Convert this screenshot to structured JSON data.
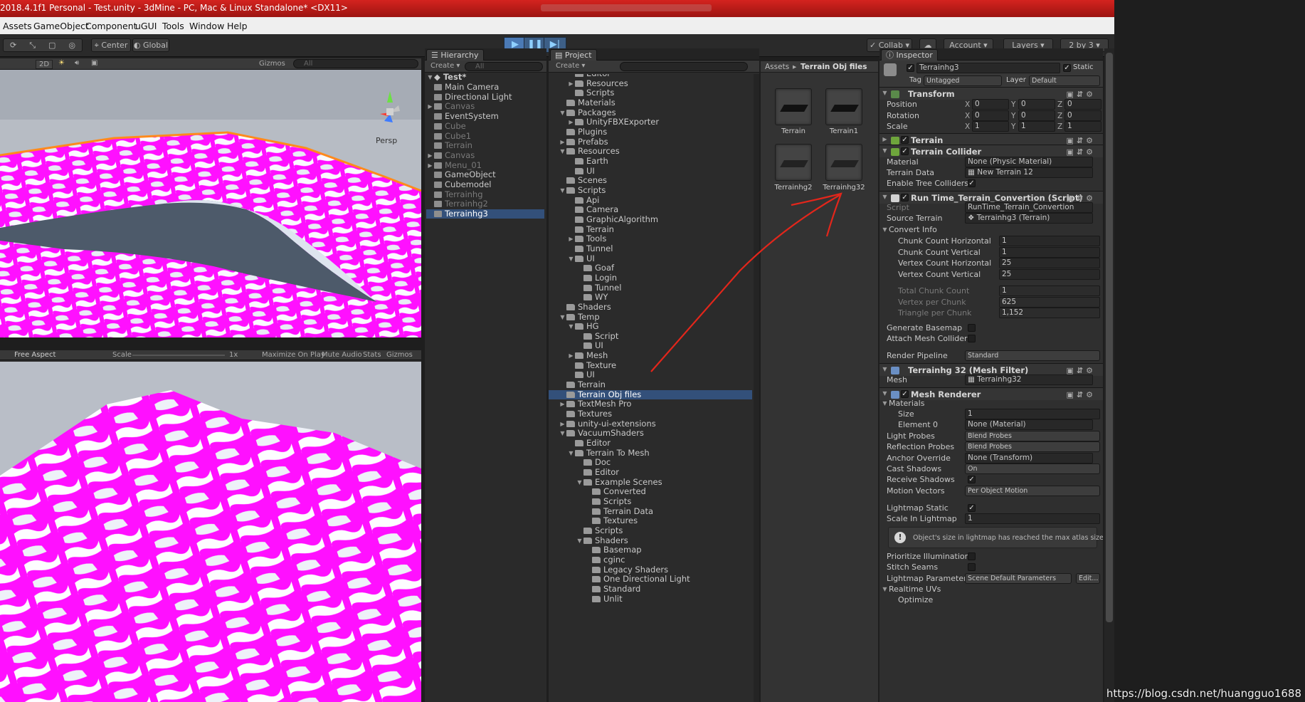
{
  "titlebar": {
    "title": "2018.4.1f1 Personal - Test.unity - 3dMine - PC, Mac & Linux Standalone* <DX11>"
  },
  "menu": [
    "Assets",
    "GameObject",
    "Component",
    "uGUI",
    "Tools",
    "Window",
    "Help"
  ],
  "toolbar": {
    "center": "Center",
    "global": "Global",
    "collab": "Collab",
    "account": "Account",
    "layers": "Layers",
    "layout": "2 by 3"
  },
  "scene": {
    "mode2d": "2D",
    "gizmos": "Gizmos",
    "search": "All",
    "persp": "Persp"
  },
  "game": {
    "aspect": "Free Aspect",
    "scale": "Scale",
    "scale_val": "1x",
    "maximize": "Maximize On Play",
    "mute": "Mute Audio",
    "stats": "Stats",
    "gizmos": "Gizmos"
  },
  "hierarchy": {
    "tab": "Hierarchy",
    "create": "Create",
    "search": "All",
    "scene": "Test*",
    "items": [
      {
        "label": "Main Camera",
        "arrow": "",
        "dim": false
      },
      {
        "label": "Directional Light",
        "arrow": "",
        "dim": false
      },
      {
        "label": "Canvas",
        "arrow": "▶",
        "dim": true
      },
      {
        "label": "EventSystem",
        "arrow": "",
        "dim": false
      },
      {
        "label": "Cube",
        "arrow": "",
        "dim": true
      },
      {
        "label": "Cube1",
        "arrow": "",
        "dim": true
      },
      {
        "label": "Terrain",
        "arrow": "",
        "dim": true
      },
      {
        "label": "Canvas",
        "arrow": "▶",
        "dim": true
      },
      {
        "label": "Menu_01",
        "arrow": "▶",
        "dim": true
      },
      {
        "label": "GameObject",
        "arrow": "",
        "dim": false
      },
      {
        "label": "Cubemodel",
        "arrow": "",
        "dim": false
      },
      {
        "label": "Terrainhg",
        "arrow": "",
        "dim": true
      },
      {
        "label": "Terrainhg2",
        "arrow": "",
        "dim": true
      },
      {
        "label": "Terrainhg3",
        "arrow": "",
        "dim": false,
        "selected": true
      }
    ]
  },
  "project": {
    "tab": "Project",
    "create": "Create",
    "tree": [
      {
        "label": "Editor",
        "level": 2,
        "arrow": ""
      },
      {
        "label": "Resources",
        "level": 2,
        "arrow": "▶"
      },
      {
        "label": "Scripts",
        "level": 2,
        "arrow": ""
      },
      {
        "label": "Materials",
        "level": 1,
        "arrow": ""
      },
      {
        "label": "Packages",
        "level": 1,
        "arrow": "▼"
      },
      {
        "label": "UnityFBXExporter",
        "level": 2,
        "arrow": "▶"
      },
      {
        "label": "Plugins",
        "level": 1,
        "arrow": ""
      },
      {
        "label": "Prefabs",
        "level": 1,
        "arrow": "▶"
      },
      {
        "label": "Resources",
        "level": 1,
        "arrow": "▼"
      },
      {
        "label": "Earth",
        "level": 2,
        "arrow": ""
      },
      {
        "label": "UI",
        "level": 2,
        "arrow": ""
      },
      {
        "label": "Scenes",
        "level": 1,
        "arrow": ""
      },
      {
        "label": "Scripts",
        "level": 1,
        "arrow": "▼"
      },
      {
        "label": "Api",
        "level": 2,
        "arrow": ""
      },
      {
        "label": "Camera",
        "level": 2,
        "arrow": ""
      },
      {
        "label": "GraphicAlgorithm",
        "level": 2,
        "arrow": ""
      },
      {
        "label": "Terrain",
        "level": 2,
        "arrow": ""
      },
      {
        "label": "Tools",
        "level": 2,
        "arrow": "▶"
      },
      {
        "label": "Tunnel",
        "level": 2,
        "arrow": ""
      },
      {
        "label": "UI",
        "level": 2,
        "arrow": "▼"
      },
      {
        "label": "Goaf",
        "level": 3,
        "arrow": ""
      },
      {
        "label": "Login",
        "level": 3,
        "arrow": ""
      },
      {
        "label": "Tunnel",
        "level": 3,
        "arrow": ""
      },
      {
        "label": "WY",
        "level": 3,
        "arrow": ""
      },
      {
        "label": "Shaders",
        "level": 1,
        "arrow": ""
      },
      {
        "label": "Temp",
        "level": 1,
        "arrow": "▼"
      },
      {
        "label": "HG",
        "level": 2,
        "arrow": "▼"
      },
      {
        "label": "Script",
        "level": 3,
        "arrow": ""
      },
      {
        "label": "UI",
        "level": 3,
        "arrow": ""
      },
      {
        "label": "Mesh",
        "level": 2,
        "arrow": "▶"
      },
      {
        "label": "Texture",
        "level": 2,
        "arrow": ""
      },
      {
        "label": "UI",
        "level": 2,
        "arrow": ""
      },
      {
        "label": "Terrain",
        "level": 1,
        "arrow": ""
      },
      {
        "label": "Terrain Obj files",
        "level": 1,
        "arrow": "",
        "selected": true
      },
      {
        "label": "TextMesh Pro",
        "level": 1,
        "arrow": "▶"
      },
      {
        "label": "Textures",
        "level": 1,
        "arrow": ""
      },
      {
        "label": "unity-ui-extensions",
        "level": 1,
        "arrow": "▶"
      },
      {
        "label": "VacuumShaders",
        "level": 1,
        "arrow": "▼"
      },
      {
        "label": "Editor",
        "level": 2,
        "arrow": ""
      },
      {
        "label": "Terrain To Mesh",
        "level": 2,
        "arrow": "▼"
      },
      {
        "label": "Doc",
        "level": 3,
        "arrow": ""
      },
      {
        "label": "Editor",
        "level": 3,
        "arrow": ""
      },
      {
        "label": "Example Scenes",
        "level": 3,
        "arrow": "▼"
      },
      {
        "label": "Converted",
        "level": 4,
        "arrow": ""
      },
      {
        "label": "Scripts",
        "level": 4,
        "arrow": ""
      },
      {
        "label": "Terrain Data",
        "level": 4,
        "arrow": ""
      },
      {
        "label": "Textures",
        "level": 4,
        "arrow": ""
      },
      {
        "label": "Scripts",
        "level": 3,
        "arrow": ""
      },
      {
        "label": "Shaders",
        "level": 3,
        "arrow": "▼"
      },
      {
        "label": "Basemap",
        "level": 4,
        "arrow": ""
      },
      {
        "label": "cginc",
        "level": 4,
        "arrow": ""
      },
      {
        "label": "Legacy Shaders",
        "level": 4,
        "arrow": ""
      },
      {
        "label": "One Directional Light",
        "level": 4,
        "arrow": ""
      },
      {
        "label": "Standard",
        "level": 4,
        "arrow": ""
      },
      {
        "label": "Unlit",
        "level": 4,
        "arrow": ""
      }
    ],
    "breadcrumb_root": "Assets",
    "breadcrumb_sep": "▸",
    "breadcrumb_current": "Terrain Obj files",
    "assets": [
      "Terrain",
      "Terrain1",
      "Terrainhg2",
      "Terrainhg32"
    ]
  },
  "inspector": {
    "tab": "Inspector",
    "name": "Terrainhg3",
    "static": "Static",
    "tag_label": "Tag",
    "tag": "Untagged",
    "layer_label": "Layer",
    "layer": "Default",
    "transform": {
      "title": "Transform",
      "rows": [
        {
          "label": "Position",
          "x": "0",
          "y": "0",
          "z": "0"
        },
        {
          "label": "Rotation",
          "x": "0",
          "y": "0",
          "z": "0"
        },
        {
          "label": "Scale",
          "x": "1",
          "y": "1",
          "z": "1"
        }
      ]
    },
    "axis": {
      "x": "X",
      "y": "Y",
      "z": "Z"
    },
    "terrain": "Terrain",
    "collider": {
      "title": "Terrain Collider",
      "material_label": "Material",
      "material": "None (Physic Material)",
      "data_label": "Terrain Data",
      "data": "New Terrain 12",
      "trees_label": "Enable Tree Colliders"
    },
    "script": {
      "title": "Run Time_Terrain_Convertion (Script)",
      "script_label": "Script",
      "script": "RunTime_Terrain_Convertion",
      "source_label": "Source Terrain",
      "source": "Terrainhg3 (Terrain)",
      "convert_info": "Convert Info",
      "params": [
        {
          "label": "Chunk Count Horizontal",
          "value": "1"
        },
        {
          "label": "Chunk Count Vertical",
          "value": "1"
        },
        {
          "label": "Vertex Count Horizontal",
          "value": "25"
        },
        {
          "label": "Vertex Count Vertical",
          "value": "25"
        }
      ],
      "readonly": [
        {
          "label": "Total Chunk Count",
          "value": "1"
        },
        {
          "label": "Vertex per Chunk",
          "value": "625"
        },
        {
          "label": "Triangle per Chunk",
          "value": "1,152"
        }
      ],
      "basemap_label": "Generate Basemap",
      "collider_label": "Attach Mesh Collider",
      "pipeline_label": "Render Pipeline",
      "pipeline": "Standard"
    },
    "meshfilter": {
      "title": "Terrainhg 32 (Mesh Filter)",
      "mesh_label": "Mesh",
      "mesh": "Terrainhg32"
    },
    "renderer": {
      "title": "Mesh Renderer",
      "materials": "Materials",
      "size_label": "Size",
      "size": "1",
      "element_label": "Element 0",
      "element": "None (Material)",
      "light_probes_label": "Light Probes",
      "light_probes": "Blend Probes",
      "refl_label": "Reflection Probes",
      "refl": "Blend Probes",
      "anchor_label": "Anchor Override",
      "anchor": "None (Transform)",
      "cast_label": "Cast Shadows",
      "cast": "On",
      "receive_label": "Receive Shadows",
      "motion_label": "Motion Vectors",
      "motion": "Per Object Motion",
      "lm_static_label": "Lightmap Static",
      "lm_scale_label": "Scale In Lightmap",
      "lm_scale": "1",
      "info": "Object's size in lightmap has reached the max atlas size.",
      "prioritize_label": "Prioritize Illumination",
      "stitch_label": "Stitch Seams",
      "lm_params_label": "Lightmap Parameters",
      "lm_params": "Scene Default Parameters",
      "edit": "Edit...",
      "realtime_label": "Realtime UVs",
      "optimize_label": "Optimize"
    }
  },
  "watermark": "https://blog.csdn.net/huangguo1688"
}
